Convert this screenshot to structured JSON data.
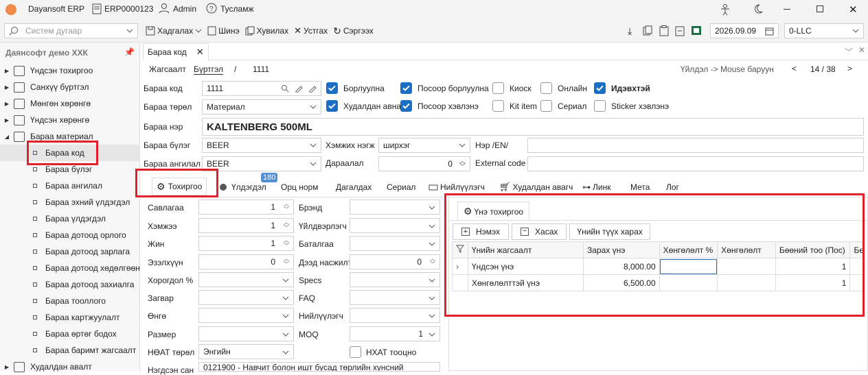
{
  "app": {
    "title": "Dayansoft ERP",
    "doc": "ERP0000123",
    "user": "Admin",
    "help": "Тусламж"
  },
  "toolbar": {
    "search_placeholder": "Систем дугаар",
    "save": "Хадгалах",
    "new": "Шинэ",
    "copy": "Хувилах",
    "delete": "Устгах",
    "refresh": "Сэргээх",
    "date": "2026.09.09",
    "company": "0-LLC"
  },
  "sidebar": {
    "title": "Даянсофт демо ХХК",
    "items": [
      {
        "label": "Үндсэн тохиргоо"
      },
      {
        "label": "Санхүү бүртгэл"
      },
      {
        "label": "Мөнгөн хөрөнгө"
      },
      {
        "label": "Үндсэн хөрөнгө"
      },
      {
        "label": "Бараа материал"
      },
      {
        "label": "Бараа код"
      },
      {
        "label": "Бараа бүлэг"
      },
      {
        "label": "Бараа ангилал"
      },
      {
        "label": "Бараа эхний үлдэгдэл"
      },
      {
        "label": "Бараа үлдэгдэл"
      },
      {
        "label": "Бараа дотоод орлого"
      },
      {
        "label": "Бараа дотоод зарлага"
      },
      {
        "label": "Бараа дотоод хөдөлгөөн"
      },
      {
        "label": "Бараа дотоод захиалга"
      },
      {
        "label": "Бараа тооллого"
      },
      {
        "label": "Бараа картжуулалт"
      },
      {
        "label": "Бараа өртөг бодох"
      },
      {
        "label": "Бараа баримт жагсаалт"
      },
      {
        "label": "Худалдан авалт"
      }
    ]
  },
  "doc_tab": "Бараа код",
  "nav": {
    "list": "Жагсаалт",
    "register": "Бүртгэл",
    "sep": "/",
    "code": "1111",
    "hint": "Үйлдэл -> Mouse баруун",
    "prev": "<",
    "page": "14 / 38",
    "next": ">"
  },
  "form": {
    "code_label": "Бараа код",
    "code": "1111",
    "type_label": "Бараа төрөл",
    "type": "Материал",
    "name_label": "Бараа нэр",
    "name": "KALTENBERG 500ML",
    "group_label": "Бараа бүлэг",
    "group": "BEER",
    "category_label": "Бараа ангилал",
    "category": "BEER",
    "unit_label": "Хэмжих нэгж",
    "unit": "ширхэг",
    "order_label": "Дараалал",
    "order": "0",
    "name_en_label": "Нэр /EN/",
    "external_label": "External code",
    "checks": [
      {
        "label": "Борлуулна",
        "on": true
      },
      {
        "label": "Посоор борлуулна",
        "on": true
      },
      {
        "label": "Киоск",
        "on": false
      },
      {
        "label": "Онлайн",
        "on": false
      },
      {
        "label": "Идэвхтэй",
        "on": true
      },
      {
        "label": "Худалдан авна",
        "on": true
      },
      {
        "label": "Посоор хэвлэнэ",
        "on": true
      },
      {
        "label": "Kit item",
        "on": false
      },
      {
        "label": "Сериал",
        "on": false
      },
      {
        "label": "Sticker хэвлэнэ",
        "on": false
      }
    ]
  },
  "tabs": {
    "settings": "Тохиргоо",
    "stock": "Үлдэгдэл",
    "stock_badge": "180",
    "bom": "Орц норм",
    "followers": "Дагалдах",
    "serial": "Сериал",
    "supplier": "Нийлүүлэгч",
    "purchase": "Худалдан авагч",
    "link": "Линк",
    "meta": "Мета",
    "log": "Лог"
  },
  "settings": {
    "left": [
      {
        "label": "Савлагаа",
        "value": "1"
      },
      {
        "label": "Хэмжээ",
        "value": "1"
      },
      {
        "label": "Жин",
        "value": "1"
      },
      {
        "label": "Эзэлхүүн",
        "value": "0"
      },
      {
        "label": "Хорогдол %",
        "value": ""
      },
      {
        "label": "Загвар",
        "value": ""
      },
      {
        "label": "Өнгө",
        "value": ""
      },
      {
        "label": "Размер",
        "value": ""
      },
      {
        "label": "НӨАТ төрөл",
        "value": "Энгийн"
      },
      {
        "label": "Нэгдсэн сан",
        "value": "0121900 - Навчит болон ишт бусад төрлийн хүнсний"
      }
    ],
    "right": [
      {
        "label": "Брэнд",
        "value": ""
      },
      {
        "label": "Үйлдвэрлэгч",
        "value": ""
      },
      {
        "label": "Баталгаа",
        "value": ""
      },
      {
        "label": "Дээд насжилт",
        "value": "0"
      },
      {
        "label": "Specs",
        "value": ""
      },
      {
        "label": "FAQ",
        "value": ""
      },
      {
        "label": "Нийлүүлэгч",
        "value": ""
      },
      {
        "label": "MOQ",
        "value": "1"
      },
      {
        "label": "НХАТ тооцно",
        "value": ""
      }
    ]
  },
  "price": {
    "tab": "Үнэ тохиргоо",
    "add": "Нэмэх",
    "remove": "Хасах",
    "history": "Үнийн түүх харах",
    "columns": [
      "Үнийн жагсаалт",
      "Зарах үнэ",
      "Хөнгөлөлт %",
      "Хөнгөлөлт",
      "Бөөний тоо (Пос)",
      "Бөөн"
    ],
    "rows": [
      [
        "Үндсэн үнэ",
        "8,000.00",
        "",
        "",
        "1",
        ""
      ],
      [
        "Хөнгөлөлттэй үнэ",
        "6,500.00",
        "",
        "",
        "1",
        ""
      ]
    ]
  }
}
